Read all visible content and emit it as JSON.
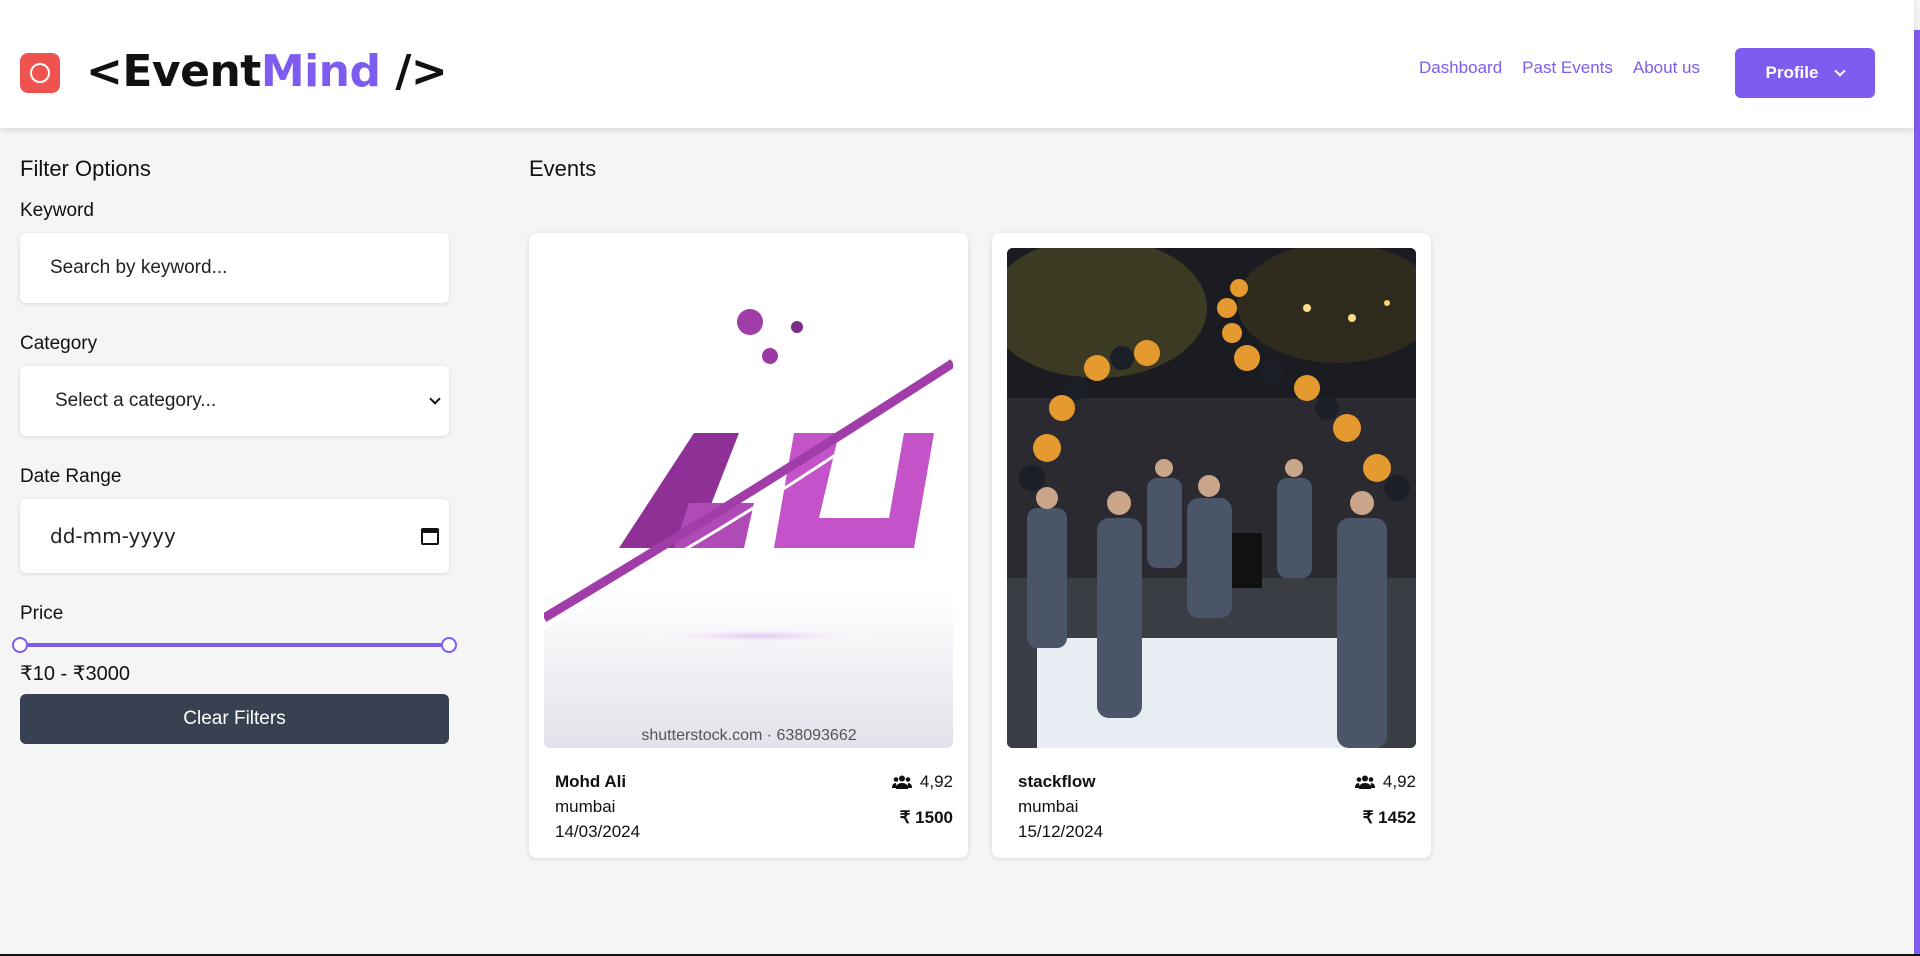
{
  "app": {
    "brand_prefix": "<Event",
    "brand_accent": "Mind",
    "brand_suffix": " />",
    "accent_color": "#7e5cf0",
    "logo_color": "#ef5350"
  },
  "nav": {
    "items": [
      "Dashboard",
      "Past Events",
      "About us"
    ],
    "profile_label": "Profile"
  },
  "filters": {
    "title": "Filter Options",
    "keyword_label": "Keyword",
    "keyword_placeholder": "Search by keyword...",
    "category_label": "Category",
    "category_selected": "Select a category...",
    "date_label": "Date Range",
    "date_placeholder": "dd-mm-yyyy",
    "price_label": "Price",
    "price_range_text": "₹10 - ₹3000",
    "price_min": 10,
    "price_max": 3000,
    "clear_label": "Clear Filters"
  },
  "events": {
    "title": "Events",
    "items": [
      {
        "organizer": "Mohd Ali",
        "city": "mumbai",
        "date": "14/03/2024",
        "attendees": "4,92",
        "price": "₹ 1500",
        "image": "ali-logo-image",
        "watermark": "shutterstock.com · 638093662"
      },
      {
        "organizer": "stackflow",
        "city": "mumbai",
        "date": "15/12/2024",
        "attendees": "4,92",
        "price": "₹ 1452",
        "image": "night-market-photo"
      }
    ]
  }
}
